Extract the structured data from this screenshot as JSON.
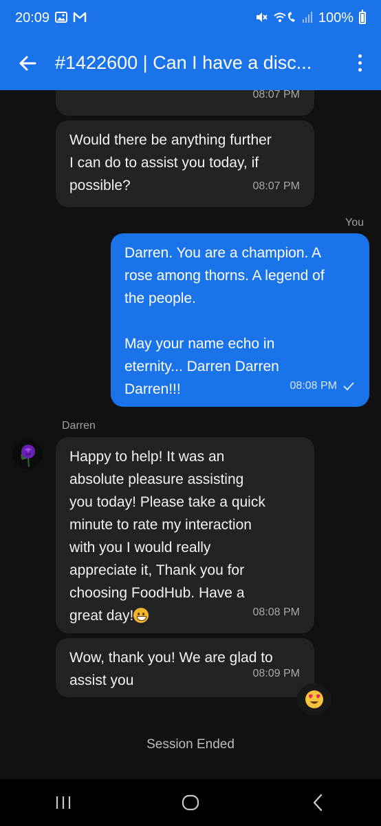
{
  "status_bar": {
    "time": "20:09",
    "battery": "100%",
    "icons": [
      "image-icon",
      "gmail-icon",
      "mute-icon",
      "wifi-call-icon",
      "signal-icon",
      "battery-icon"
    ]
  },
  "app_bar": {
    "title": "#1422600 | Can I have a disc...",
    "back_icon": "back-arrow-icon",
    "menu_icon": "more-vert-icon"
  },
  "chat": {
    "messages": [
      {
        "from": "agent",
        "text": "",
        "time": "08:07 PM"
      },
      {
        "from": "agent",
        "text": "Would there be anything further\nI can do to assist you today, if\npossible?",
        "time": "08:07 PM"
      },
      {
        "from": "me",
        "label": "You",
        "text": "Darren. You are a champion. A\nrose among thorns. A legend of\nthe people.\n\nMay your name echo in\neternity... Darren Darren\nDarren!!!",
        "time": "08:08 PM",
        "status_icon": "check-icon"
      },
      {
        "from": "agent",
        "sender": "Darren",
        "text": "Happy to help! It was an\nabsolute pleasure assisting\nyou today! Please take a quick\nminute to rate my interaction\nwith you I would really\nappreciate it, Thank you for\nchoosing FoodHub. Have a\ngreat day!",
        "time": "08:08 PM",
        "emoji": "grinning-face-emoji"
      },
      {
        "from": "agent",
        "text": "Wow, thank you! We are glad to\nassist you",
        "time": "08:09 PM",
        "reaction": "heart-eyes-emoji"
      }
    ],
    "session_text": "Session Ended"
  },
  "nav_bar": {
    "icons": [
      "recents-icon",
      "home-icon",
      "back-icon"
    ]
  },
  "colors": {
    "header": "#1a73e8",
    "background": "#111111",
    "agent_bubble": "#232323",
    "user_bubble": "#1a73e8"
  }
}
